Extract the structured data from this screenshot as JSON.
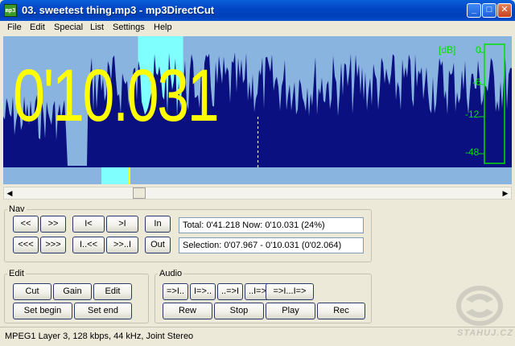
{
  "window": {
    "title": "03. sweetest thing.mp3 - mp3DirectCut",
    "app_icon": "mp3-icon",
    "controls": {
      "minimize": "minimize-icon",
      "maximize": "maximize-icon",
      "close": "close-icon"
    }
  },
  "menu": [
    "File",
    "Edit",
    "Special",
    "List",
    "Settings",
    "Help"
  ],
  "waveform": {
    "time_display": "0'10.031",
    "db_labels": {
      "unit": "[dB]",
      "zero": "0",
      "minus6": "-6",
      "minus12": "-12",
      "minus48": "-48"
    },
    "selection_fraction": [
      0.186,
      0.243
    ],
    "cursor_fraction": 0.243,
    "colors": {
      "background": "#8ab4e0",
      "wave": "#0a1080",
      "selection": "#80ffff",
      "time": "#ffff00",
      "meter": "#00e000"
    }
  },
  "scrollbar": {
    "left": "◀",
    "right": "▶",
    "position_fraction": 0.26
  },
  "nav": {
    "label": "Nav",
    "buttons": [
      "<<",
      ">>",
      "I<",
      ">I",
      "<<<",
      ">>>",
      "I..<<",
      ">>..I"
    ],
    "in_label": "In",
    "out_label": "Out",
    "total_line": "Total: 0'41.218   Now: 0'10.031   (24%)",
    "selection_line": "Selection: 0'07.967 - 0'10.031 (0'02.064)"
  },
  "edit": {
    "label": "Edit",
    "cut": "Cut",
    "gain": "Gain",
    "edit": "Edit",
    "set_begin": "Set begin",
    "set_end": "Set end"
  },
  "audio": {
    "label": "Audio",
    "seek": [
      "=>I..",
      "I=>..",
      "..=>I",
      "..I=>",
      "=>I...I=>"
    ],
    "rew": "Rew",
    "stop": "Stop",
    "play": "Play",
    "rec": "Rec"
  },
  "status": {
    "text": "MPEG1 Layer 3, 128 kbps, 44 kHz, Joint Stereo",
    "watermark": "STAHUJ.CZ"
  }
}
